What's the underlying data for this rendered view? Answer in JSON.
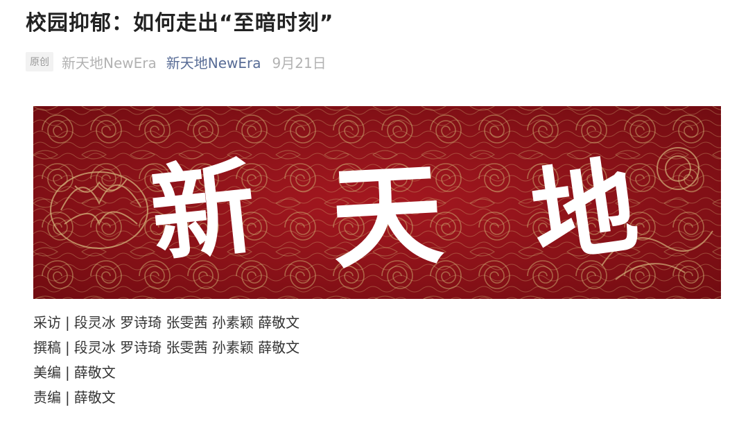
{
  "article": {
    "title": "校园抑郁：如何走出“至暗时刻”",
    "badge": "原创",
    "author": "新天地NewEra",
    "account": "新天地NewEra",
    "date": "9月21日"
  },
  "banner": {
    "alt": "新天地 calligraphy on red embroidered silk",
    "calligraphy": [
      "新",
      "天",
      "地"
    ],
    "colors": {
      "background": "#8f1017",
      "pattern": "#c9a66b",
      "text": "#ffffff"
    }
  },
  "credits": [
    {
      "role": "采访",
      "sep": "|",
      "names": "段灵冰 罗诗琦 张雯茜 孙素颖 薛敬文"
    },
    {
      "role": "撰稿",
      "sep": "|",
      "names": "段灵冰 罗诗琦 张雯茜 孙素颖 薛敬文"
    },
    {
      "role": "美编",
      "sep": "|",
      "names": "薛敬文"
    },
    {
      "role": "责编",
      "sep": "|",
      "names": "薛敬文"
    }
  ]
}
